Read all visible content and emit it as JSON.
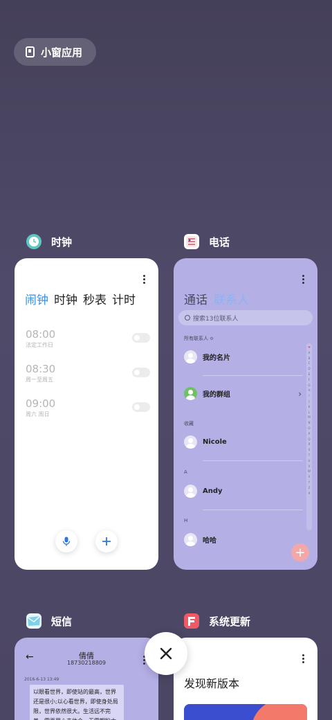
{
  "small_window": {
    "label": "小窗应用",
    "icon": "small-window-icon"
  },
  "apps": {
    "clock": {
      "name": "时钟",
      "icon": "clock-app-icon",
      "tabs": [
        "闹钟",
        "时钟",
        "秒表",
        "计时"
      ],
      "alarms": [
        {
          "time": "08:00",
          "repeat": "法定工作日"
        },
        {
          "time": "08:30",
          "repeat": "周一至周五"
        },
        {
          "time": "09:00",
          "repeat": "周六 周日"
        }
      ]
    },
    "phone": {
      "name": "电话",
      "icon": "phone-app-icon",
      "tabs": [
        "通话",
        "联系人"
      ],
      "search_placeholder": "搜索13位联系人",
      "all_contacts": "所有联系人 ≎",
      "my_card": "我的名片",
      "my_groups": "我的群组",
      "section_fav": "收藏",
      "fav_contact": "Nicole",
      "section_a": "A",
      "contact_a": "Andy",
      "section_h": "H",
      "contact_h": "哈哈",
      "index": [
        "♥",
        "A",
        "B",
        "C",
        "D",
        "E",
        "F",
        "G",
        "H",
        "I",
        "J",
        "K",
        "L",
        "M",
        "N",
        "O",
        "P",
        "Q",
        "R",
        "S",
        "T",
        "U",
        "V",
        "W",
        "X",
        "Y",
        "Z",
        "#"
      ]
    },
    "messages": {
      "name": "短信",
      "icon": "messages-app-icon",
      "contact_name": "倩倩",
      "contact_number": "18730218809",
      "date": "2016-6-13 13:49",
      "message": "以眼看世界，即使站的最高，世界还是很小;以心看世界，即使身处局限，世界依然很大。生活远不完美，需要用心去体会，无需期盼太"
    },
    "update": {
      "name": "系统更新",
      "icon": "system-update-app-icon",
      "title": "发现新版本"
    }
  },
  "close_icon": "close-icon"
}
